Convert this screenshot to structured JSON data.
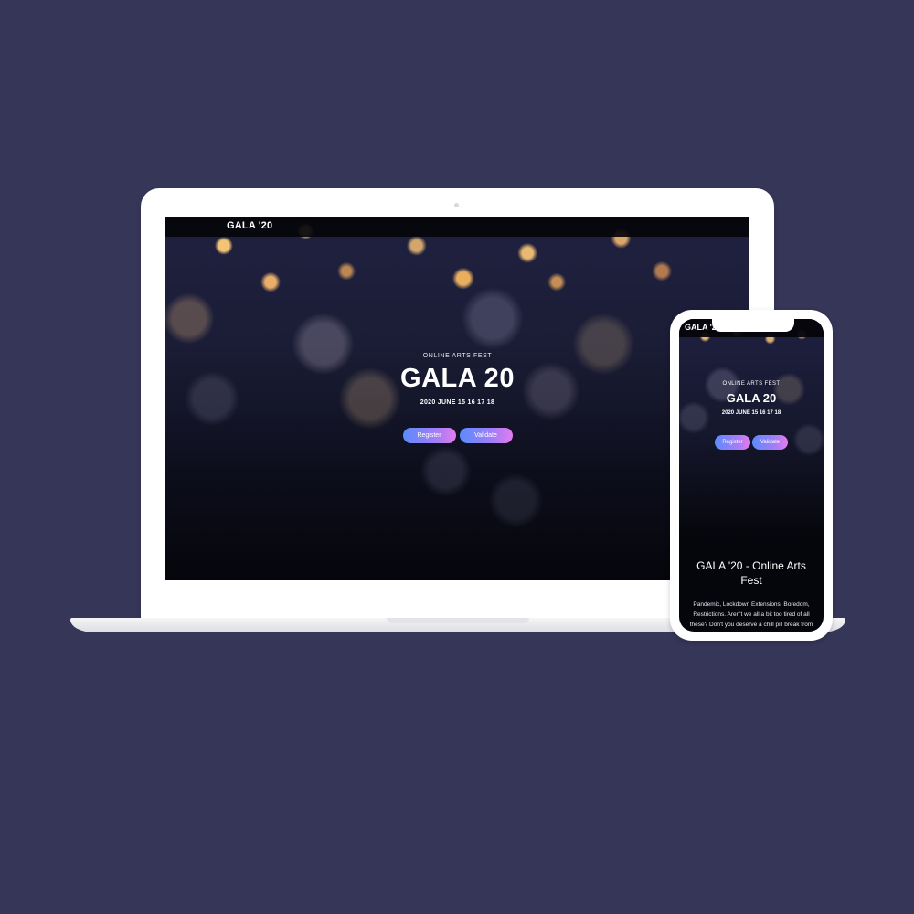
{
  "laptop": {
    "nav": {
      "logo": "GALA '20"
    },
    "hero": {
      "eyebrow": "ONLINE ARTS FEST",
      "title": "GALA 20",
      "date": "2020 JUNE 15 16 17 18"
    },
    "buttons": {
      "register": "Register",
      "validate": "Validate"
    }
  },
  "phone": {
    "nav": {
      "logo": "GALA '20"
    },
    "hero": {
      "eyebrow": "ONLINE ARTS FEST",
      "title": "GALA 20",
      "date": "2020 JUNE 15 16 17 18"
    },
    "buttons": {
      "register": "Register",
      "validate": "Validate"
    },
    "section": {
      "heading": "GALA '20 - Online Arts Fest",
      "body": "Pandemic, Lockdown Extensions, Boredom, Restrictions. Aren't we all a bit too tired of all these? Don't you deserve a chill pill break from all the mess, your GALA. Not Another Online"
    }
  },
  "colors": {
    "background": "#363659",
    "button_gradient_start": "#5b8cff",
    "button_gradient_end": "#e47cf0"
  }
}
